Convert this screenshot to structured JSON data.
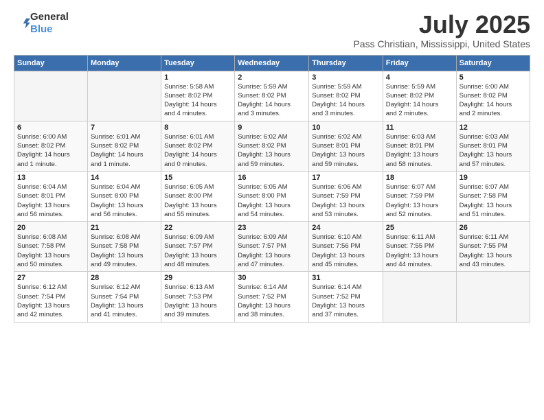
{
  "logo": {
    "general": "General",
    "blue": "Blue"
  },
  "title": {
    "month_year": "July 2025",
    "location": "Pass Christian, Mississippi, United States"
  },
  "weekdays": [
    "Sunday",
    "Monday",
    "Tuesday",
    "Wednesday",
    "Thursday",
    "Friday",
    "Saturday"
  ],
  "weeks": [
    [
      {
        "day": "",
        "info": ""
      },
      {
        "day": "",
        "info": ""
      },
      {
        "day": "1",
        "info": "Sunrise: 5:58 AM\nSunset: 8:02 PM\nDaylight: 14 hours\nand 4 minutes."
      },
      {
        "day": "2",
        "info": "Sunrise: 5:59 AM\nSunset: 8:02 PM\nDaylight: 14 hours\nand 3 minutes."
      },
      {
        "day": "3",
        "info": "Sunrise: 5:59 AM\nSunset: 8:02 PM\nDaylight: 14 hours\nand 3 minutes."
      },
      {
        "day": "4",
        "info": "Sunrise: 5:59 AM\nSunset: 8:02 PM\nDaylight: 14 hours\nand 2 minutes."
      },
      {
        "day": "5",
        "info": "Sunrise: 6:00 AM\nSunset: 8:02 PM\nDaylight: 14 hours\nand 2 minutes."
      }
    ],
    [
      {
        "day": "6",
        "info": "Sunrise: 6:00 AM\nSunset: 8:02 PM\nDaylight: 14 hours\nand 1 minute."
      },
      {
        "day": "7",
        "info": "Sunrise: 6:01 AM\nSunset: 8:02 PM\nDaylight: 14 hours\nand 1 minute."
      },
      {
        "day": "8",
        "info": "Sunrise: 6:01 AM\nSunset: 8:02 PM\nDaylight: 14 hours\nand 0 minutes."
      },
      {
        "day": "9",
        "info": "Sunrise: 6:02 AM\nSunset: 8:02 PM\nDaylight: 13 hours\nand 59 minutes."
      },
      {
        "day": "10",
        "info": "Sunrise: 6:02 AM\nSunset: 8:01 PM\nDaylight: 13 hours\nand 59 minutes."
      },
      {
        "day": "11",
        "info": "Sunrise: 6:03 AM\nSunset: 8:01 PM\nDaylight: 13 hours\nand 58 minutes."
      },
      {
        "day": "12",
        "info": "Sunrise: 6:03 AM\nSunset: 8:01 PM\nDaylight: 13 hours\nand 57 minutes."
      }
    ],
    [
      {
        "day": "13",
        "info": "Sunrise: 6:04 AM\nSunset: 8:01 PM\nDaylight: 13 hours\nand 56 minutes."
      },
      {
        "day": "14",
        "info": "Sunrise: 6:04 AM\nSunset: 8:00 PM\nDaylight: 13 hours\nand 56 minutes."
      },
      {
        "day": "15",
        "info": "Sunrise: 6:05 AM\nSunset: 8:00 PM\nDaylight: 13 hours\nand 55 minutes."
      },
      {
        "day": "16",
        "info": "Sunrise: 6:05 AM\nSunset: 8:00 PM\nDaylight: 13 hours\nand 54 minutes."
      },
      {
        "day": "17",
        "info": "Sunrise: 6:06 AM\nSunset: 7:59 PM\nDaylight: 13 hours\nand 53 minutes."
      },
      {
        "day": "18",
        "info": "Sunrise: 6:07 AM\nSunset: 7:59 PM\nDaylight: 13 hours\nand 52 minutes."
      },
      {
        "day": "19",
        "info": "Sunrise: 6:07 AM\nSunset: 7:58 PM\nDaylight: 13 hours\nand 51 minutes."
      }
    ],
    [
      {
        "day": "20",
        "info": "Sunrise: 6:08 AM\nSunset: 7:58 PM\nDaylight: 13 hours\nand 50 minutes."
      },
      {
        "day": "21",
        "info": "Sunrise: 6:08 AM\nSunset: 7:58 PM\nDaylight: 13 hours\nand 49 minutes."
      },
      {
        "day": "22",
        "info": "Sunrise: 6:09 AM\nSunset: 7:57 PM\nDaylight: 13 hours\nand 48 minutes."
      },
      {
        "day": "23",
        "info": "Sunrise: 6:09 AM\nSunset: 7:57 PM\nDaylight: 13 hours\nand 47 minutes."
      },
      {
        "day": "24",
        "info": "Sunrise: 6:10 AM\nSunset: 7:56 PM\nDaylight: 13 hours\nand 45 minutes."
      },
      {
        "day": "25",
        "info": "Sunrise: 6:11 AM\nSunset: 7:55 PM\nDaylight: 13 hours\nand 44 minutes."
      },
      {
        "day": "26",
        "info": "Sunrise: 6:11 AM\nSunset: 7:55 PM\nDaylight: 13 hours\nand 43 minutes."
      }
    ],
    [
      {
        "day": "27",
        "info": "Sunrise: 6:12 AM\nSunset: 7:54 PM\nDaylight: 13 hours\nand 42 minutes."
      },
      {
        "day": "28",
        "info": "Sunrise: 6:12 AM\nSunset: 7:54 PM\nDaylight: 13 hours\nand 41 minutes."
      },
      {
        "day": "29",
        "info": "Sunrise: 6:13 AM\nSunset: 7:53 PM\nDaylight: 13 hours\nand 39 minutes."
      },
      {
        "day": "30",
        "info": "Sunrise: 6:14 AM\nSunset: 7:52 PM\nDaylight: 13 hours\nand 38 minutes."
      },
      {
        "day": "31",
        "info": "Sunrise: 6:14 AM\nSunset: 7:52 PM\nDaylight: 13 hours\nand 37 minutes."
      },
      {
        "day": "",
        "info": ""
      },
      {
        "day": "",
        "info": ""
      }
    ]
  ]
}
